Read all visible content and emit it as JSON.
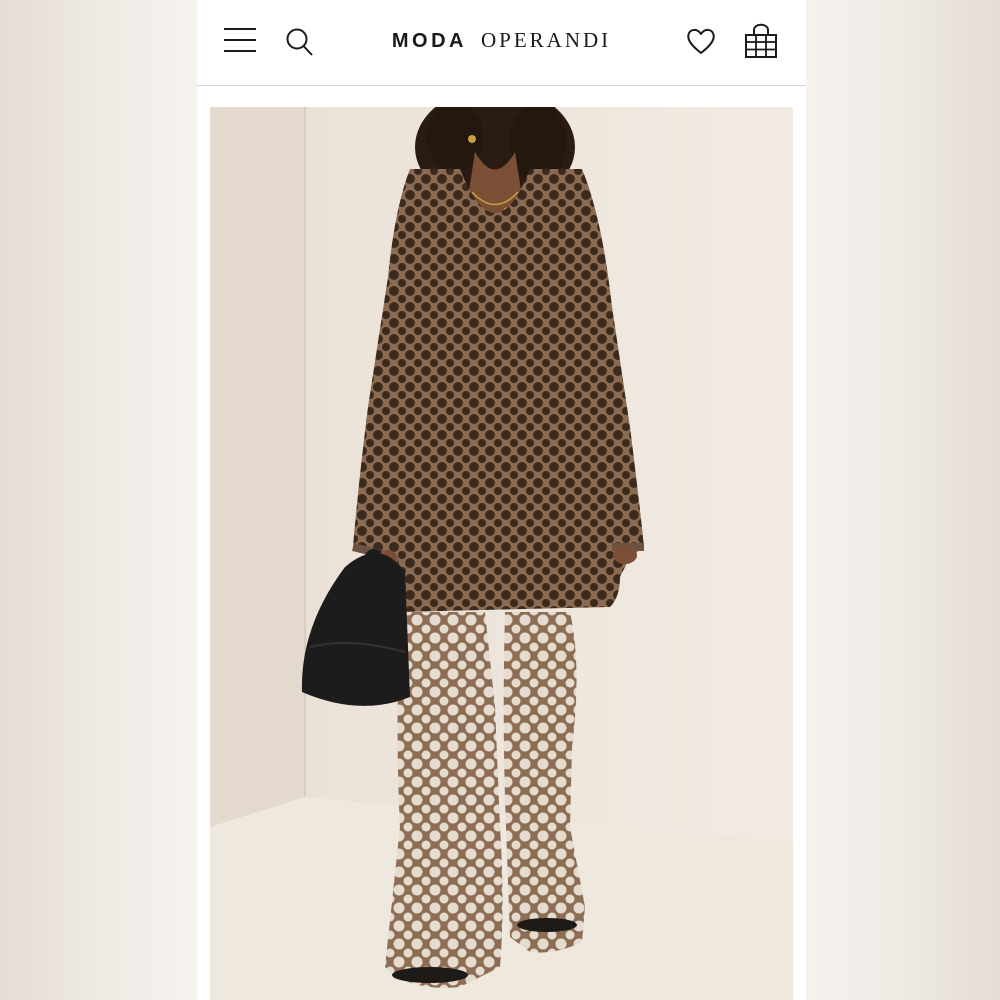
{
  "app": {
    "logo_word_1": "MODA",
    "logo_word_2": "OPERANDI"
  },
  "header": {
    "icons": [
      "menu-icon",
      "search-icon",
      "heart-icon",
      "shopping-bag-icon"
    ]
  },
  "colors": {
    "background": "#f6f3ef",
    "header": "#ffffff",
    "logo": "#1a1a1a",
    "garment": "#8d6e55",
    "bag": "#1c1c1c"
  }
}
